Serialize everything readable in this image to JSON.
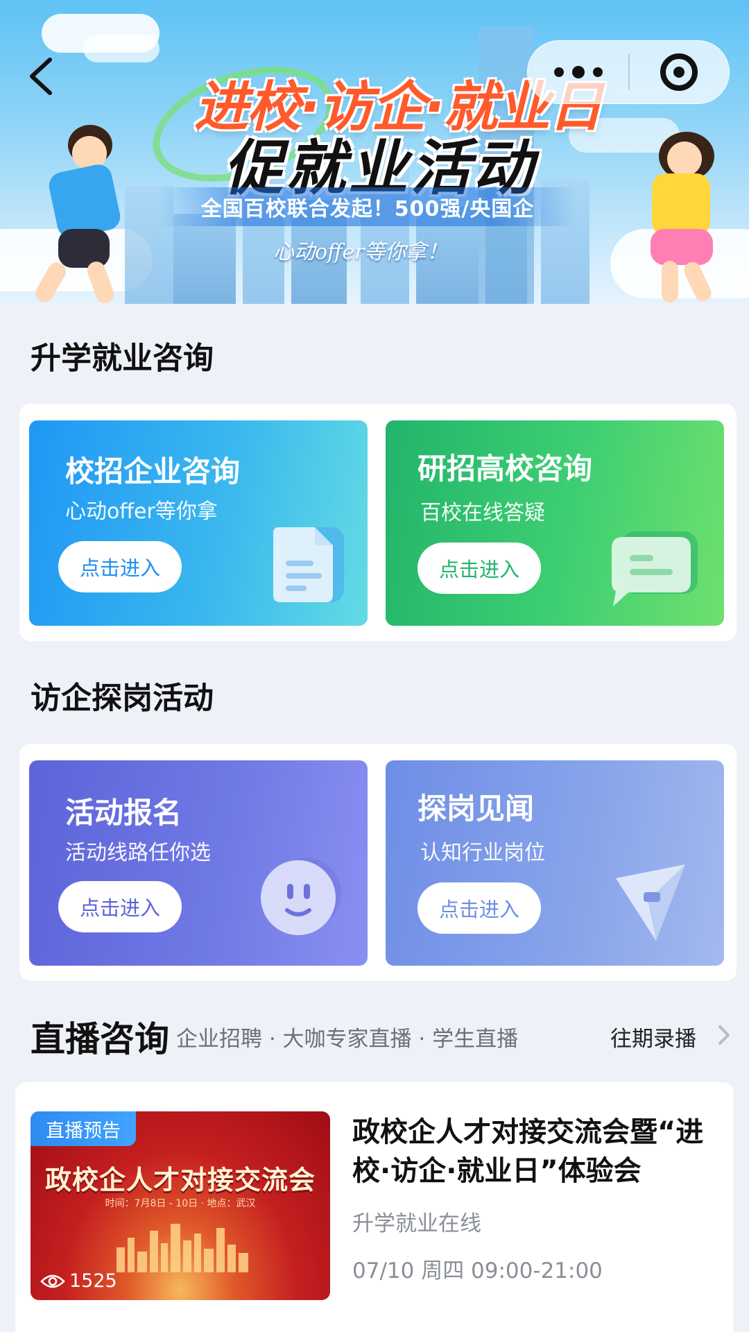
{
  "banner": {
    "title_line1": "进校·访企·就业日",
    "title_line2": "促就业活动",
    "subtitle": "全国百校联合发起！500强/央国企",
    "slogan": "心动offer等你拿！"
  },
  "nav": {
    "back_icon": "chevron-left-icon",
    "more_icon": "more-dots-icon",
    "close_icon": "target-circle-icon"
  },
  "section_consult": {
    "title": "升学就业咨询",
    "cards": [
      {
        "title": "校招企业咨询",
        "subtitle": "心动offer等你拿",
        "button": "点击进入",
        "icon": "document-icon",
        "button_color": "#1e8ff0"
      },
      {
        "title": "研招高校咨询",
        "subtitle": "百校在线答疑",
        "button": "点击进入",
        "icon": "chat-bubble-icon",
        "button_color": "#22b46b"
      }
    ]
  },
  "section_visit": {
    "title": "访企探岗活动",
    "cards": [
      {
        "title": "活动报名",
        "subtitle": "活动线路任你选",
        "button": "点击进入",
        "icon": "smiley-icon",
        "button_color": "#5d63d9"
      },
      {
        "title": "探岗见闻",
        "subtitle": "认知行业岗位",
        "button": "点击进入",
        "icon": "send-plane-icon",
        "button_color": "#6e8ee6"
      }
    ]
  },
  "live": {
    "title": "直播咨询",
    "tags": "企业招聘 · 大咖专家直播 · 学生直播",
    "past_label": "往期录播",
    "item": {
      "badge": "直播预告",
      "thumb_title": "政校企人才对接交流会",
      "thumb_subtitle": "时间：7月8日 - 10日 · 地点：武汉",
      "views": "1525",
      "title": "政校企人才对接交流会暨“进校·访企·就业日”体验会",
      "organizer": "升学就业在线",
      "time": "07/10 周四 09:00-21:00"
    }
  },
  "colors": {
    "page_bg": "#eef1f8",
    "card_blue": "#1f97f5",
    "card_green": "#22b46b",
    "card_purple": "#5d63d9",
    "card_periwinkle": "#6e8ee6",
    "badge_blue": "#2e8af0"
  }
}
